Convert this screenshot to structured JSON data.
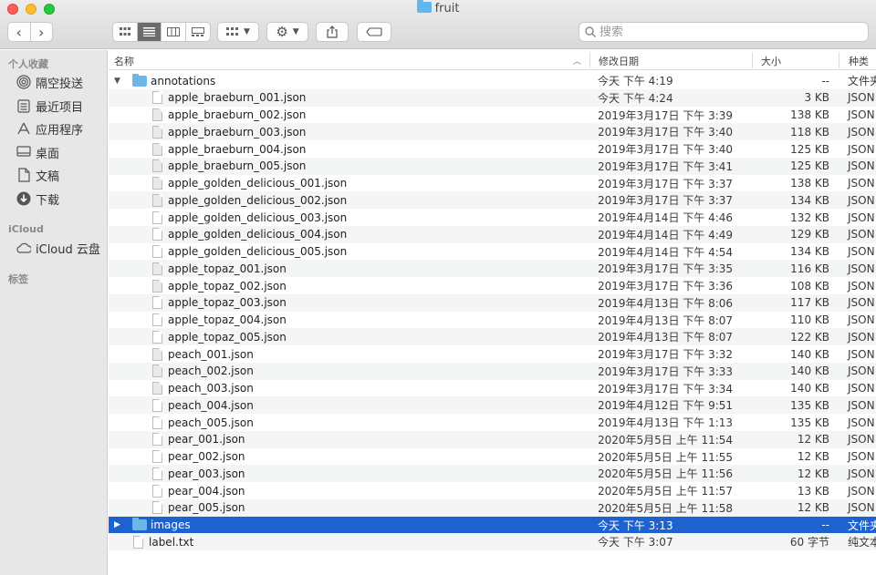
{
  "window": {
    "title": "fruit"
  },
  "toolbar": {
    "back": "‹",
    "forward": "›",
    "search_placeholder": "搜索"
  },
  "sidebar": {
    "favorites_heading": "个人收藏",
    "favorites": [
      {
        "label": "隔空投送",
        "icon": "airdrop-icon"
      },
      {
        "label": "最近项目",
        "icon": "recents-icon"
      },
      {
        "label": "应用程序",
        "icon": "applications-icon"
      },
      {
        "label": "桌面",
        "icon": "desktop-icon"
      },
      {
        "label": "文稿",
        "icon": "documents-icon"
      },
      {
        "label": "下载",
        "icon": "downloads-icon"
      }
    ],
    "icloud_heading": "iCloud",
    "icloud_items": [
      {
        "label": "iCloud 云盘",
        "icon": "cloud-icon"
      }
    ],
    "tags_heading": "标签"
  },
  "columns": {
    "name": "名称",
    "date": "修改日期",
    "size": "大小",
    "kind": "种类"
  },
  "rows": [
    {
      "name": "annotations",
      "date": "今天 下午 4:19",
      "size": "--",
      "kind": "文件夹",
      "type": "folder",
      "expanded": true
    },
    {
      "name": "apple_braeburn_001.json",
      "date": "今天 下午 4:24",
      "size": "3 KB",
      "kind": "JSON",
      "type": "file"
    },
    {
      "name": "apple_braeburn_002.json",
      "date": "2019年3月17日 下午 3:39",
      "size": "138 KB",
      "kind": "JSON",
      "type": "file"
    },
    {
      "name": "apple_braeburn_003.json",
      "date": "2019年3月17日 下午 3:40",
      "size": "118 KB",
      "kind": "JSON",
      "type": "file"
    },
    {
      "name": "apple_braeburn_004.json",
      "date": "2019年3月17日 下午 3:40",
      "size": "125 KB",
      "kind": "JSON",
      "type": "file"
    },
    {
      "name": "apple_braeburn_005.json",
      "date": "2019年3月17日 下午 3:41",
      "size": "125 KB",
      "kind": "JSON",
      "type": "file"
    },
    {
      "name": "apple_golden_delicious_001.json",
      "date": "2019年3月17日 下午 3:37",
      "size": "138 KB",
      "kind": "JSON",
      "type": "file"
    },
    {
      "name": "apple_golden_delicious_002.json",
      "date": "2019年3月17日 下午 3:37",
      "size": "134 KB",
      "kind": "JSON",
      "type": "file"
    },
    {
      "name": "apple_golden_delicious_003.json",
      "date": "2019年4月14日 下午 4:46",
      "size": "132 KB",
      "kind": "JSON",
      "type": "file"
    },
    {
      "name": "apple_golden_delicious_004.json",
      "date": "2019年4月14日 下午 4:49",
      "size": "129 KB",
      "kind": "JSON",
      "type": "file"
    },
    {
      "name": "apple_golden_delicious_005.json",
      "date": "2019年4月14日 下午 4:54",
      "size": "134 KB",
      "kind": "JSON",
      "type": "file"
    },
    {
      "name": "apple_topaz_001.json",
      "date": "2019年3月17日 下午 3:35",
      "size": "116 KB",
      "kind": "JSON",
      "type": "file"
    },
    {
      "name": "apple_topaz_002.json",
      "date": "2019年3月17日 下午 3:36",
      "size": "108 KB",
      "kind": "JSON",
      "type": "file"
    },
    {
      "name": "apple_topaz_003.json",
      "date": "2019年4月13日 下午 8:06",
      "size": "117 KB",
      "kind": "JSON",
      "type": "file"
    },
    {
      "name": "apple_topaz_004.json",
      "date": "2019年4月13日 下午 8:07",
      "size": "110 KB",
      "kind": "JSON",
      "type": "file"
    },
    {
      "name": "apple_topaz_005.json",
      "date": "2019年4月13日 下午 8:07",
      "size": "122 KB",
      "kind": "JSON",
      "type": "file"
    },
    {
      "name": "peach_001.json",
      "date": "2019年3月17日 下午 3:32",
      "size": "140 KB",
      "kind": "JSON",
      "type": "file"
    },
    {
      "name": "peach_002.json",
      "date": "2019年3月17日 下午 3:33",
      "size": "140 KB",
      "kind": "JSON",
      "type": "file"
    },
    {
      "name": "peach_003.json",
      "date": "2019年3月17日 下午 3:34",
      "size": "140 KB",
      "kind": "JSON",
      "type": "file"
    },
    {
      "name": "peach_004.json",
      "date": "2019年4月12日 下午 9:51",
      "size": "135 KB",
      "kind": "JSON",
      "type": "file"
    },
    {
      "name": "peach_005.json",
      "date": "2019年4月13日 下午 1:13",
      "size": "135 KB",
      "kind": "JSON",
      "type": "file"
    },
    {
      "name": "pear_001.json",
      "date": "2020年5月5日 上午 11:54",
      "size": "12 KB",
      "kind": "JSON",
      "type": "file"
    },
    {
      "name": "pear_002.json",
      "date": "2020年5月5日 上午 11:55",
      "size": "12 KB",
      "kind": "JSON",
      "type": "file"
    },
    {
      "name": "pear_003.json",
      "date": "2020年5月5日 上午 11:56",
      "size": "12 KB",
      "kind": "JSON",
      "type": "file"
    },
    {
      "name": "pear_004.json",
      "date": "2020年5月5日 上午 11:57",
      "size": "13 KB",
      "kind": "JSON",
      "type": "file"
    },
    {
      "name": "pear_005.json",
      "date": "2020年5月5日 上午 11:58",
      "size": "12 KB",
      "kind": "JSON",
      "type": "file"
    },
    {
      "name": "images",
      "date": "今天 下午 3:13",
      "size": "--",
      "kind": "文件夹",
      "type": "folder",
      "expanded": false,
      "selected": true
    },
    {
      "name": "label.txt",
      "date": "今天 下午 3:07",
      "size": "60 字节",
      "kind": "纯文本",
      "type": "file"
    }
  ]
}
